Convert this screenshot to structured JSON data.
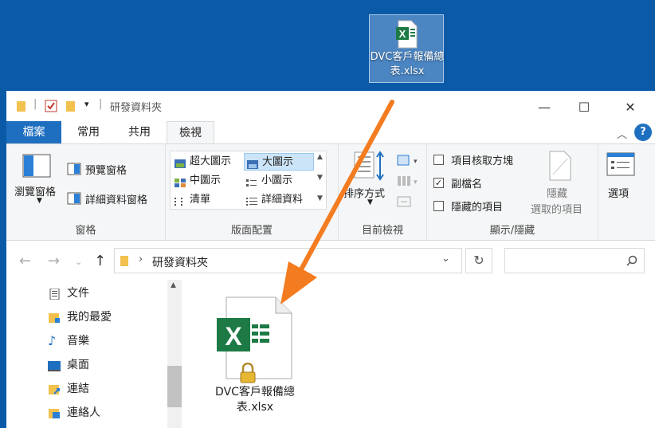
{
  "desktop": {
    "file_name": "DVC客戶報備總表.xlsx"
  },
  "window": {
    "title": "研發資料夾",
    "controls": {
      "minimize": "—",
      "maximize": "☐",
      "close": "✕"
    }
  },
  "tabs": {
    "file": "檔案",
    "home": "常用",
    "share": "共用",
    "view": "檢視"
  },
  "ribbon": {
    "panes": {
      "label": "窗格",
      "nav_pane": "瀏覽窗格",
      "preview_pane": "預覽窗格",
      "details_pane": "詳細資料窗格"
    },
    "layout": {
      "label": "版面配置",
      "options": [
        "超大圖示",
        "大圖示",
        "中圖示",
        "小圖示",
        "清單",
        "詳細資料"
      ],
      "selected": "大圖示"
    },
    "current_view": {
      "label": "目前檢視",
      "sort_by": "排序方式"
    },
    "show_hide": {
      "label": "顯示/隱藏",
      "item_checkboxes": "項目核取方塊",
      "file_extensions": "副檔名",
      "hidden_items": "隱藏的項目",
      "hide_selected_line1": "隱藏",
      "hide_selected_line2": "選取的項目",
      "item_checkboxes_checked": false,
      "file_extensions_checked": true,
      "hidden_items_checked": false
    },
    "options": "選項"
  },
  "address": {
    "folder": "研發資料夾"
  },
  "nav_pane": {
    "items": [
      "文件",
      "我的最愛",
      "音樂",
      "桌面",
      "連結",
      "連絡人"
    ]
  },
  "content": {
    "file_name": "DVC客戶報備總表.xlsx"
  },
  "colors": {
    "excel_green": "#1d7a45",
    "accent": "#1f6fc0",
    "arrow": "#f47c20"
  }
}
